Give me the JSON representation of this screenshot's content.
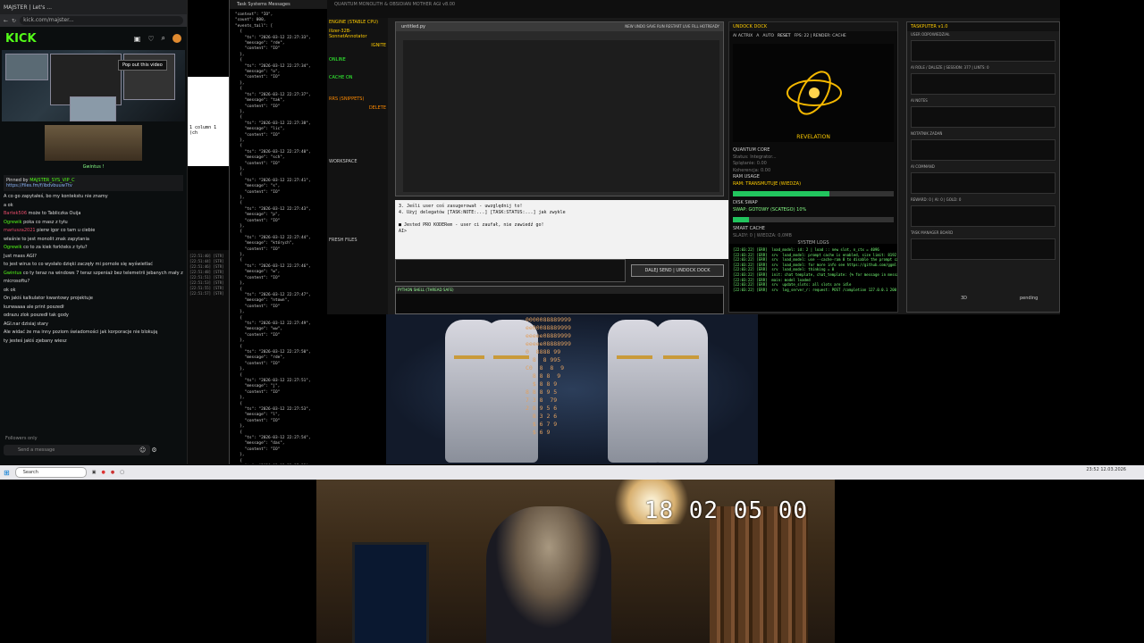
{
  "kick": {
    "tab_label": "MAJSTER | Let's ...",
    "url": "kick.com/majster...",
    "logo": "KICK",
    "popout": "Pop out this video",
    "cam_label": "Gwintus !",
    "pinned_by": "Pinned by",
    "pinned_user": "MAJSTER_SYS_VIP_C",
    "pinned_link": "https://files.fm/f/ibdvbuuw7tv",
    "chat": [
      {
        "user": "",
        "msg": "A co go zapytałeś, bo my kontekstu nie znamy"
      },
      {
        "user": "",
        "msg": "a ok"
      },
      {
        "user": "Bartek506",
        "msg": "może to Tabliczka Ouija"
      },
      {
        "user": "",
        "msg": ""
      },
      {
        "user": "Ogrewik",
        "msg": "poka co masz z tyłu"
      },
      {
        "user": "mariusza2021",
        "msg": "pierw igor co tam u ciebie"
      },
      {
        "user": "",
        "msg": "właśnie to jest monolit znak zapytania"
      },
      {
        "user": "Ogrewik",
        "msg": "co to za kiek forkteks z tyłu?"
      },
      {
        "user": "",
        "msg": "Just mass AGI?"
      },
      {
        "user": "",
        "msg": "to jest wirus to co wysłało dzięki zaczęły mi pornole się wyświetlać"
      },
      {
        "user": "Gwintus",
        "msg": "co ty teraz na windows 7 teraz szpeniaż bez telemetrii jebanych mały z microsoftu?"
      },
      {
        "user": "",
        "msg": "ok ok"
      },
      {
        "user": "",
        "msg": "On jakiś kalkulator kwantowy projektuje"
      },
      {
        "user": "",
        "msg": "kurwaaaa ale print poszedł"
      },
      {
        "user": "",
        "msg": "odrazu zlok poszedł tak gody"
      },
      {
        "user": "",
        "msg": "AGI.nar dzisiaj stary"
      },
      {
        "user": "",
        "msg": "Ale widać że ma inny poziom świadomości jak korporacje nie blokują"
      },
      {
        "user": "",
        "msg": "ty jesteś jakiś zjebany wiesz"
      }
    ],
    "followers_only": "Followers only",
    "send_placeholder": "Send a message"
  },
  "terminal": {
    "line1": "1 column 1 (ch"
  },
  "task_messages": {
    "title": "Task Systems Messages",
    "log": "\"context\": \"IO\",\n\"count\": 000,\n\"events_tail\": [\n  {\n    \"ts\": \"2026-03-12 22:27:33\",\n    \"message\": \"rde\",\n    \"content\": \"IO\"\n  },\n  {\n    \"ts\": \"2026-03-12 22:27:34\",\n    \"message\": \"o\",\n    \"content\": \"IO\"\n  },\n  {\n    \"ts\": \"2026-03-12 22:27:37\",\n    \"message\": \"tak\",\n    \"content\": \"IO\"\n  },\n  {\n    \"ts\": \"2026-03-12 22:27:38\",\n    \"message\": \"lic\",\n    \"content\": \"IO\"\n  },\n  {\n    \"ts\": \"2026-03-12 22:27:40\",\n    \"message\": \"sch\",\n    \"content\": \"IO\"\n  },\n  {\n    \"ts\": \"2026-03-12 22:27:41\",\n    \"message\": \"s\",\n    \"content\": \"IO\"\n  },\n  {\n    \"ts\": \"2026-03-12 22:27:43\",\n    \"message\": \"p\",\n    \"content\": \"IO\"\n  },\n  {\n    \"ts\": \"2026-03-12 22:27:44\",\n    \"message\": \"których\",\n    \"content\": \"IO\"\n  },\n  {\n    \"ts\": \"2026-03-12 22:27:46\",\n    \"message\": \"w\",\n    \"content\": \"IO\"\n  },\n  {\n    \"ts\": \"2026-03-12 22:27:47\",\n    \"message\": \"ntown\",\n    \"content\": \"IO\"\n  },\n  {\n    \"ts\": \"2026-03-12 22:27:49\",\n    \"message\": \"ww\",\n    \"content\": \"IO\"\n  },\n  {\n    \"ts\": \"2026-03-12 22:27:50\",\n    \"message\": \"rde\",\n    \"content\": \"IO\"\n  },\n  {\n    \"ts\": \"2026-03-12 22:27:51\",\n    \"message\": \"j\",\n    \"content\": \"IO\"\n  },\n  {\n    \"ts\": \"2026-03-12 22:27:53\",\n    \"message\": \"l\",\n    \"content\": \"IO\"\n  },\n  {\n    \"ts\": \"2026-03-12 22:27:54\",\n    \"message\": \"das\",\n    \"content\": \"IO\"\n  },\n  {\n    \"ts\": \"2026-03-12 22:27:55\",\n    \"message\": \"ze\",\n    \"content\": \"IO\"\n  },\n  {\n    \"ts\": \"2026-03-12 22:27:56\",\n    \"message\": \"n\",\n    \"content\": \"IO\"\n  }"
  },
  "ide": {
    "title": "QUANTUM MONOLITH & OBSIDIAN MOTHER AGI v8.00",
    "left_header": "ENGINE (STABLE CPU)",
    "left_model": "ilizer-32B-SonnetAnnotator",
    "left_ignite": "IGNITE",
    "left_online": "ONLINE",
    "left_cache": "CACHE ON",
    "left_snippets": "RRS (SNIPPETS)",
    "left_delete": "DELETE",
    "left_workspace": "WORKSPACE",
    "left_fresh": "FRESH FILES",
    "editor_tab": "untitled.py",
    "editor_menu": "NEW  UNDO  SAVE  RUN  RESTART  LIVE FILL  HOTREADY",
    "term_lines": [
      "3. Jeśli user coś zasugerował - uwzględnij to!",
      "4. Użyj delegatów [TASK:NOTE:...] [TASK:STATUS:...] jak zwykle",
      "",
      "■ Jested PRO KODERem - user ci zaufał, nie zawiedź go!",
      "AI>"
    ],
    "send_button": "DALEJ SEND | UNDOCK DOCK",
    "shell_header": "PYTHON SHELL (THREAD SAFE)"
  },
  "dock": {
    "header": "UNDOCK  DOCK",
    "bar_items": [
      "AI ACTRIX",
      "A",
      "AUTO",
      "RESET",
      "FPS: 22 | RENDER: CACHE"
    ],
    "viz_label": "REVELATION",
    "quantum_core": "QUANTUM CORE",
    "status_lines": [
      "Status: Integrator...",
      "Splątanie: 0.00",
      "Koherencja: 0.00"
    ],
    "ram_usage": "RAM USAGE",
    "ram_state": "RAM: TRANSMUTUJE (WIEDZA)",
    "ram_fill": 0.6,
    "disk_swap": "DISK SWAP",
    "swap_state": "SWAP: GOTOWY (SCATEGO) 10%",
    "swap_fill": 0.1,
    "smart_cache": "SMART CACHE",
    "cache_state": "SLADY: 0 | WIEDZA: 0,0MB",
    "log_title": "SYSTEM LOGS",
    "log": "[22:03:22] [ERR]  load_model: id: 2 | load :: new slot, n_ctx = 4096\n[22:03:22] [ERR]  srv  load_model: prompt cache is enabled, size limit: 8192 MiB\n[22:03:22] [ERR]  srv  load_model: use --cache-ram 0 to disable the prompt cache\n[22:03:22] [ERR]  srv  load_model: for more info see https://github.com/ggml-org\n[22:03:22] [ERR]  srv  load_model: thinking = 0\n[22:03:22] [ERR]  init: chat template, chat_template: {% for message in messages %}\n[22:03:22] [ERR]  main: model loaded\n[22:03:22] [ERR]  srv  update_slots: all slots are idle\n[22:03:22] [ERR]  srv  log_server_r: request: POST /completion 127.0.0.1 200"
  },
  "taskputer": {
    "header": "TASKPUTER v1.0",
    "rows": [
      "USER ODPOWIEDZIAŁ",
      "AI ROLE / DALSZE | SESSION: 377 | LINTS: 0",
      "AI NOTES",
      "NOTATNIK ZADAŃ",
      "AI COMMAND",
      "REWARD: 0 | AI: 0 | GOLD: 0",
      "TASK MANAGER BOARD"
    ],
    "mode": "3D",
    "pending": "pending"
  },
  "video": {
    "matrix": "0000088889999\nee00088889999\neeeee08889999\neeeee08888999\n0  8888 99\n  8  8 995\nC0  8  8  9\n  8 8 8  9\n  $ 8 8 9\n8 8 8 9 5\n7 3 8  79\n2 8 9 5 6\n  8 3 2 6\n  $ 6 7 9\n  $ 6 9"
  },
  "taskbar": {
    "search": "Search",
    "tray": "23:52 12.03.2026"
  },
  "webcam": {
    "timestamp": "18 02 05 00"
  }
}
